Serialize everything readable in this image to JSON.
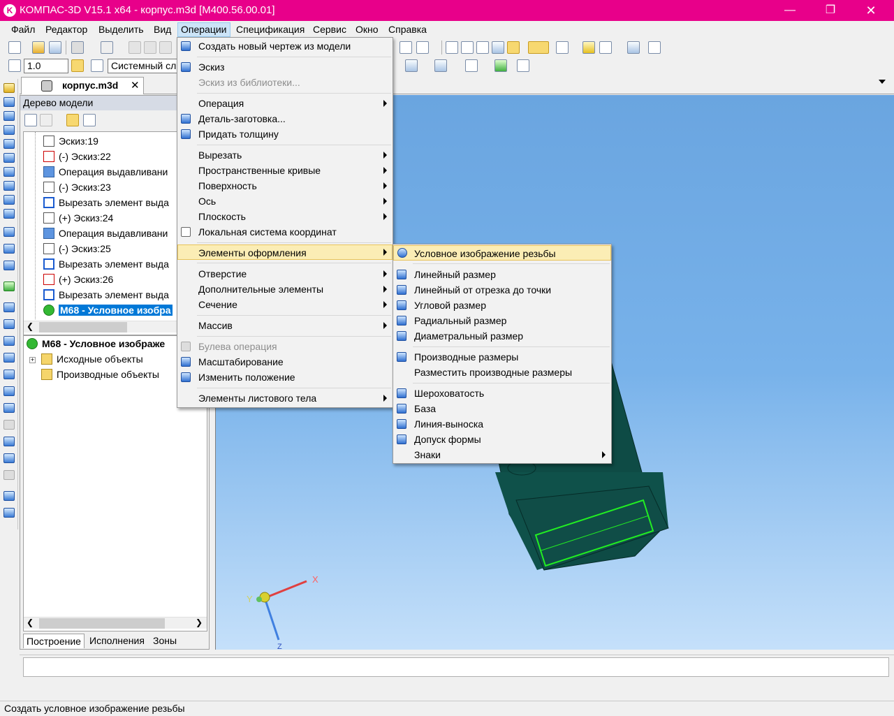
{
  "window": {
    "title": "КОМПАС-3D V15.1 x64 - корпус.m3d [M400.56.00.01]",
    "logo": "K"
  },
  "menubar": [
    "Файл",
    "Редактор",
    "Выделить",
    "Вид",
    "Операции",
    "Спецификация",
    "Сервис",
    "Окно",
    "Справка"
  ],
  "toolbar": {
    "scale_value": "1.0",
    "cs_value": "Системный сл"
  },
  "document_tab": "корпус.m3d",
  "tree": {
    "header": "Дерево модели",
    "items": [
      "Эскиз:19",
      "(-) Эскиз:22",
      "Операция выдавливани",
      "(-) Эскиз:23",
      "Вырезать элемент выда",
      "(+) Эскиз:24",
      "Операция выдавливани",
      "(-) Эскиз:25",
      "Вырезать элемент выда",
      "(+) Эскиз:26",
      "Вырезать элемент выда",
      "M68 - Условное изобра"
    ],
    "props_title": "M68 - Условное изображе",
    "props_items": [
      "Исходные объекты",
      "Производные объекты"
    ],
    "bottom_tabs": [
      "Построение",
      "Исполнения",
      "Зоны"
    ]
  },
  "operations_menu": [
    "Создать новый чертеж из модели",
    "Эскиз",
    "Эскиз из библиотеки...",
    "Операция",
    "Деталь-заготовка...",
    "Придать толщину",
    "Вырезать",
    "Пространственные кривые",
    "Поверхность",
    "Ось",
    "Плоскость",
    "Локальная система координат",
    "Элементы оформления",
    "Отверстие",
    "Дополнительные элементы",
    "Сечение",
    "Массив",
    "Булева операция",
    "Масштабирование",
    "Изменить положение",
    "Элементы листового тела"
  ],
  "decor_submenu": [
    "Условное изображение резьбы",
    "Линейный размер",
    "Линейный от отрезка до точки",
    "Угловой размер",
    "Радиальный размер",
    "Диаметральный размер",
    "Производные размеры",
    "Разместить производные размеры",
    "Шероховатость",
    "База",
    "Линия-выноска",
    "Допуск формы",
    "Знаки"
  ],
  "axes": {
    "x": "X",
    "y": "Y",
    "z": "Z"
  },
  "status_text": "Создать условное изображение резьбы",
  "colors": {
    "titlebar": "#e8008a",
    "highlight": "#fbedb5",
    "selection": "#0078d7",
    "model": "#0e4b45",
    "edge_highlight": "#22ee22"
  }
}
